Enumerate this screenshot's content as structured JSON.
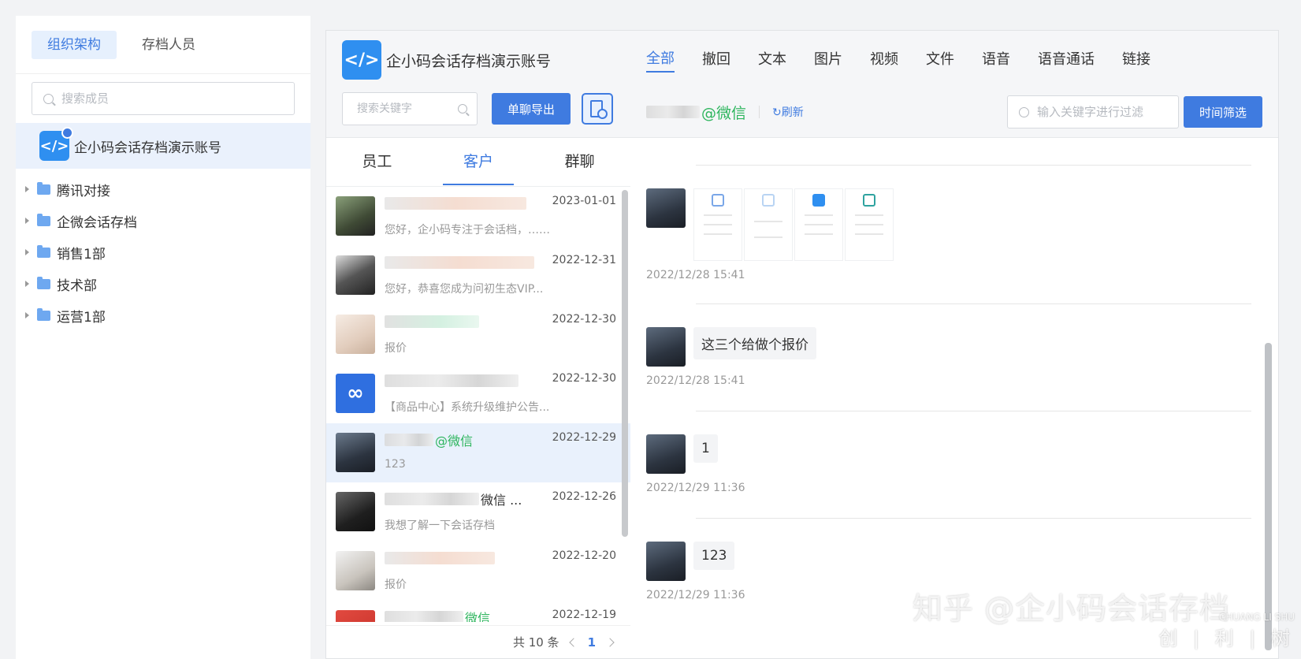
{
  "org": {
    "tabs": [
      {
        "label": "组织架构",
        "active": true
      },
      {
        "label": "存档人员",
        "active": false
      }
    ],
    "search_placeholder": "搜索成员",
    "account_name": "企小码会话存档演示账号",
    "departments": [
      "腾讯对接",
      "企微会话存档",
      "销售1部",
      "技术部",
      "运营1部"
    ]
  },
  "conversation": {
    "title": "企小码会话存档演示账号",
    "keyword_placeholder": "搜索关键字",
    "export_label": "单聊导出",
    "subtabs": [
      {
        "label": "员工",
        "active": false
      },
      {
        "label": "客户",
        "active": true
      },
      {
        "label": "群聊",
        "active": false
      }
    ],
    "rows": [
      {
        "date": "2023-01-01",
        "preview": "您好，企小码专注于会话档，……",
        "wx": "",
        "avatar": "#5a6b4c"
      },
      {
        "date": "2022-12-31",
        "preview": "您好，恭喜您成为问初生态VIP...",
        "wx": "",
        "avatar": "#444"
      },
      {
        "date": "2022-12-30",
        "preview": "报价",
        "wx": "",
        "avatar": "#e8d8cc"
      },
      {
        "date": "2022-12-30",
        "preview": "【商品中心】系统升级维护公告...",
        "wx": "",
        "avatar": "#2f6fe0"
      },
      {
        "date": "2022-12-29",
        "preview": "123",
        "wx": "@微信",
        "avatar": "#3a4452",
        "active": true
      },
      {
        "date": "2022-12-26",
        "preview": "我想了解一下会话存档",
        "wx": "微信 ...",
        "avatar": "#2a2a2a"
      },
      {
        "date": "2022-12-20",
        "preview": "报价",
        "wx": "",
        "avatar": "#c9c4bd"
      },
      {
        "date": "2022-12-19",
        "preview": "",
        "wx": "微信",
        "avatar": "#d43c35"
      }
    ],
    "pager": {
      "total": "共 10 条",
      "page": "1"
    }
  },
  "messages": {
    "type_tabs": [
      {
        "label": "全部",
        "active": true
      },
      {
        "label": "撤回",
        "active": false
      },
      {
        "label": "文本",
        "active": false
      },
      {
        "label": "图片",
        "active": false
      },
      {
        "label": "视频",
        "active": false
      },
      {
        "label": "文件",
        "active": false
      },
      {
        "label": "语音",
        "active": false
      },
      {
        "label": "语音通话",
        "active": false
      },
      {
        "label": "链接",
        "active": false
      }
    ],
    "chat_suffix": "@微信",
    "refresh_label": "刷新",
    "filter_placeholder": "输入关键字进行过滤",
    "time_filter_label": "时间筛选",
    "items": [
      {
        "type": "images",
        "time": "2022/12/28 15:41"
      },
      {
        "type": "text",
        "text": "这三个给做个报价",
        "time": "2022/12/28 15:41"
      },
      {
        "type": "text",
        "text": "1",
        "time": "2022/12/29 11:36"
      },
      {
        "type": "text",
        "text": "123",
        "time": "2022/12/29 11:36"
      }
    ]
  },
  "watermark": {
    "text": "知乎 @企小码会话存档",
    "badge_top": "CHUANG LI SHU",
    "badge_bottom": "创 | 利 | 树"
  }
}
